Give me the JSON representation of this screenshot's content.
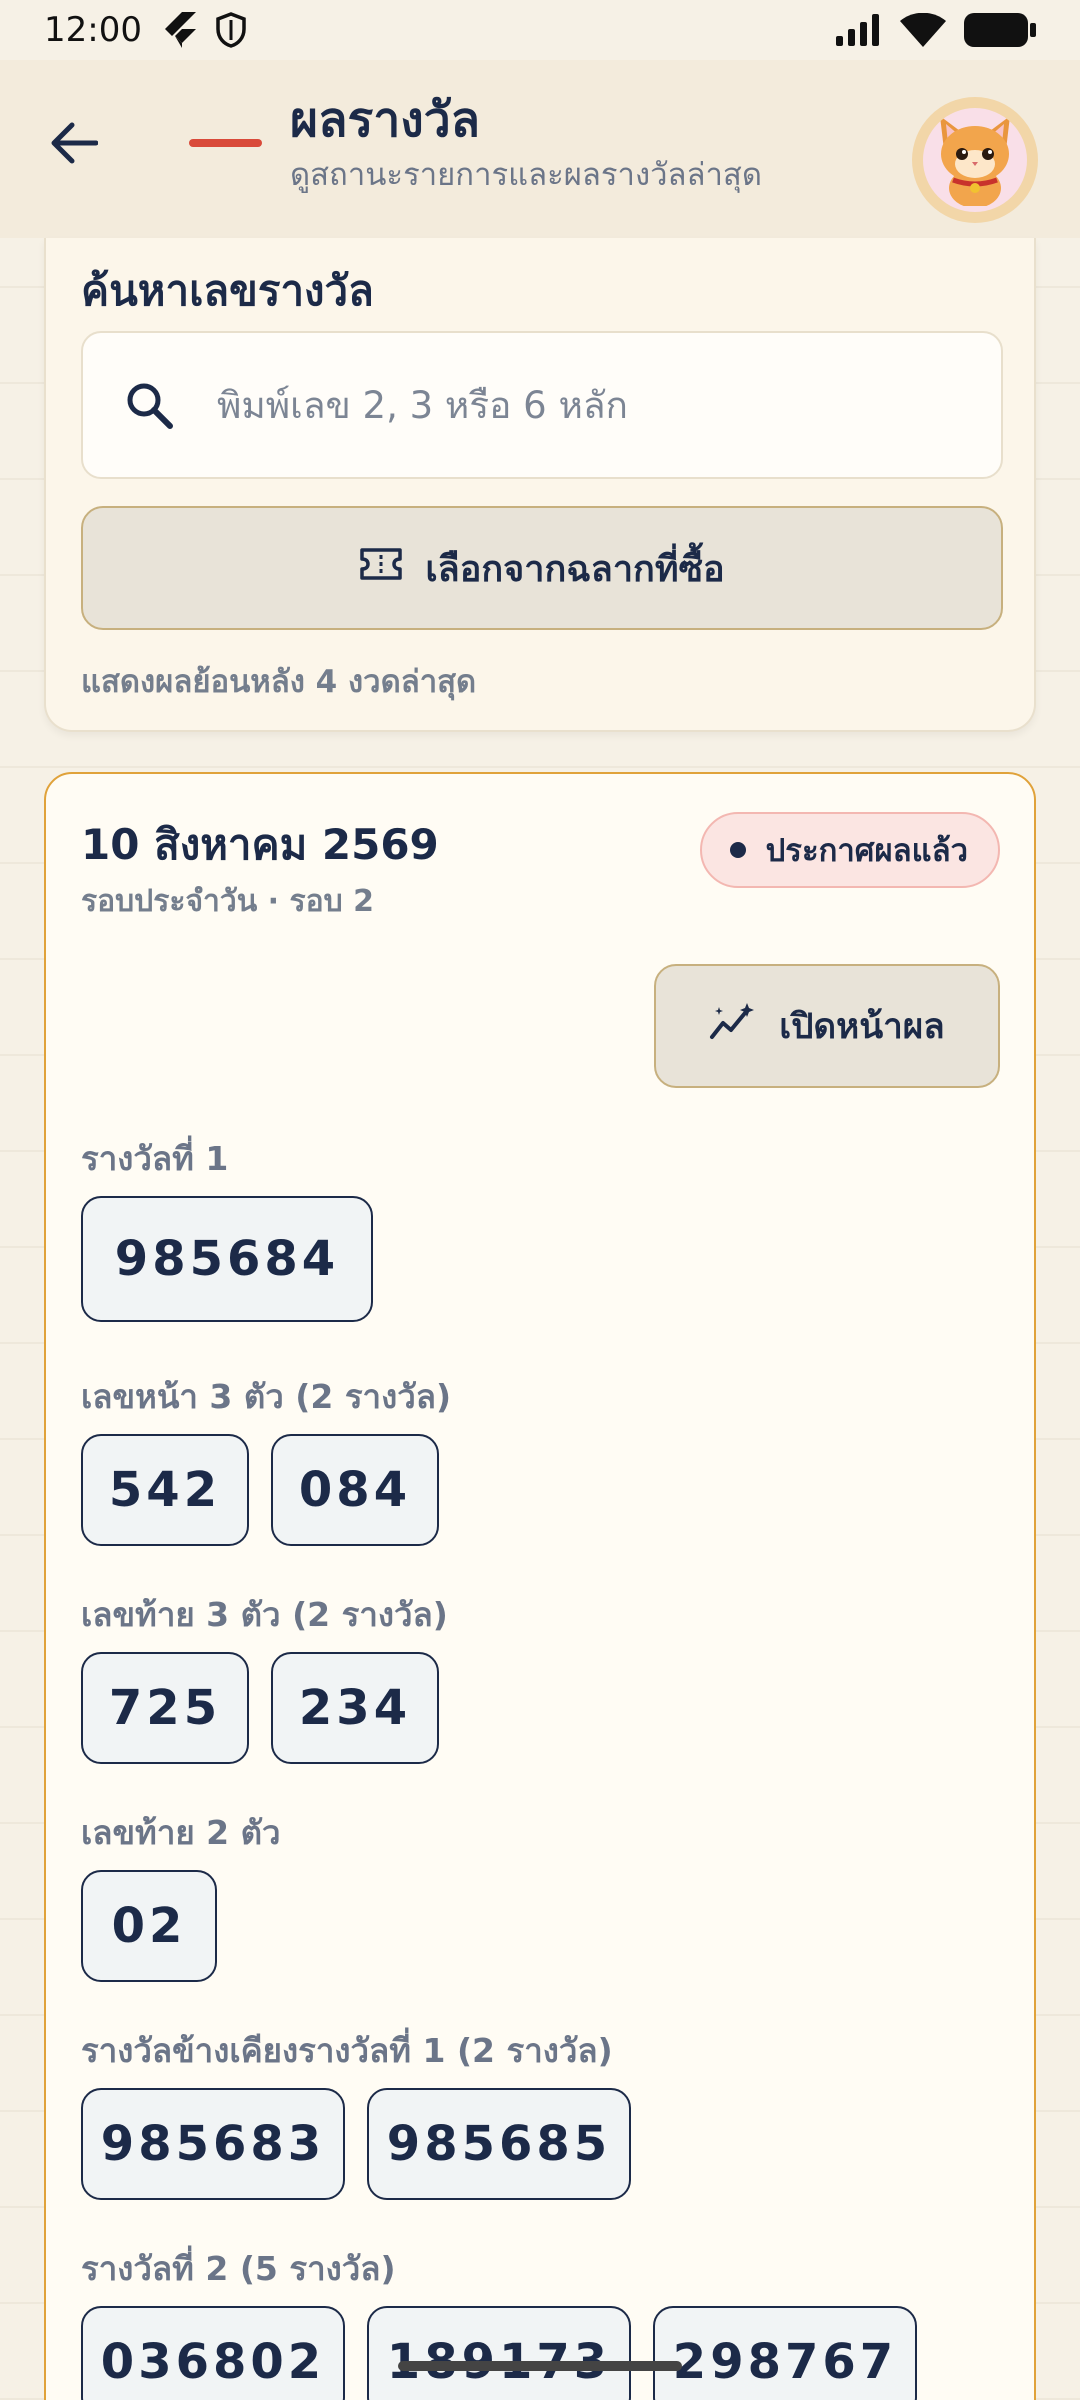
{
  "status_bar": {
    "time": "12:00"
  },
  "header": {
    "title": "ผลรางวัล",
    "subtitle": "ดูสถานะรายการและผลรางวัลล่าสุด"
  },
  "search": {
    "heading": "ค้นหาเลขรางวัล",
    "placeholder": "พิมพ์เลข 2, 3 หรือ 6 หลัก",
    "ticket_button": "เลือกจากฉลากที่ซื้อ",
    "history_note": "แสดงผลย้อนหลัง 4 งวดล่าสุด"
  },
  "result": {
    "date": "10 สิงหาคม 2569",
    "round": "รอบประจำวัน · รอบ 2",
    "status": "ประกาศผลแล้ว",
    "open_button": "เปิดหน้าผล",
    "sections": [
      {
        "label": "รางวัลที่ 1",
        "numbers": [
          "985684"
        ]
      },
      {
        "label": "เลขหน้า 3 ตัว (2 รางวัล)",
        "numbers": [
          "542",
          "084"
        ]
      },
      {
        "label": "เลขท้าย 3 ตัว (2 รางวัล)",
        "numbers": [
          "725",
          "234"
        ]
      },
      {
        "label": "เลขท้าย 2 ตัว",
        "numbers": [
          "02"
        ]
      },
      {
        "label": "รางวัลข้างเคียงรางวัลที่ 1 (2 รางวัล)",
        "numbers": [
          "985683",
          "985685"
        ]
      },
      {
        "label": "รางวัลที่ 2 (5 รางวัล)",
        "numbers": [
          "036802",
          "189173",
          "298767"
        ]
      }
    ]
  },
  "colors": {
    "accent_red": "#d94a3a",
    "navy": "#1c2a48",
    "card_border_orange": "#e0a23a"
  },
  "icons": [
    "back-arrow-icon",
    "search-icon",
    "ticket-icon",
    "sparkle-chart-icon",
    "cat-avatar-icon"
  ]
}
